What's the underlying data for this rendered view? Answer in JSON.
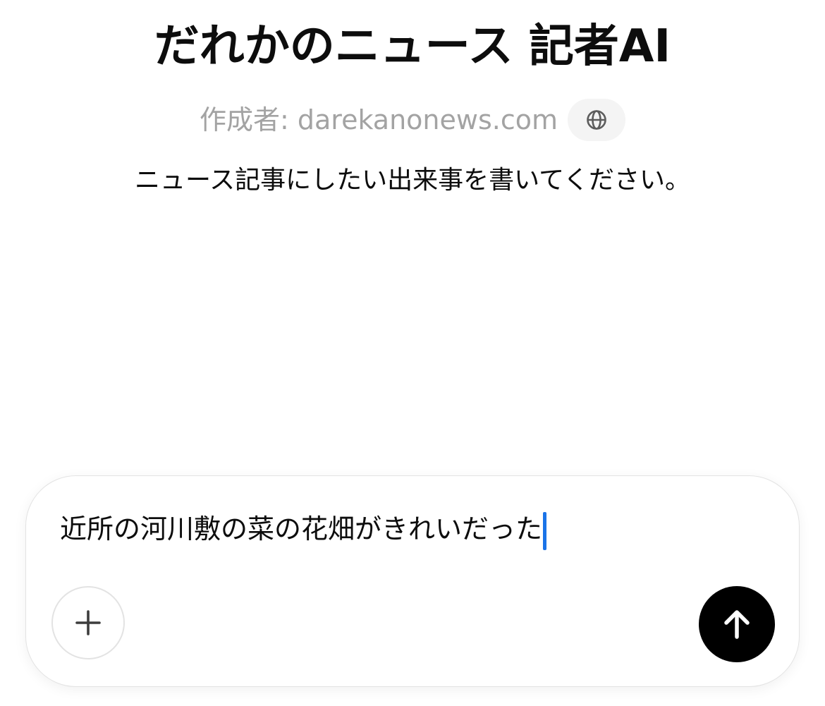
{
  "gpt": {
    "title": "だれかのニュース 記者AI",
    "author": "作成者: darekanonews.com",
    "website_icon": "globe-icon",
    "description": "ニュース記事にしたい出来事を書いてください。"
  },
  "composer": {
    "value": "近所の河川敷の菜の花畑がきれいだった",
    "attach_icon": "plus-icon",
    "send_icon": "arrow-up-icon"
  },
  "colors": {
    "author_text": "#a3a3a3",
    "caret": "#1a73e8",
    "send_button": "#000000",
    "border": "#e3e3e3"
  }
}
